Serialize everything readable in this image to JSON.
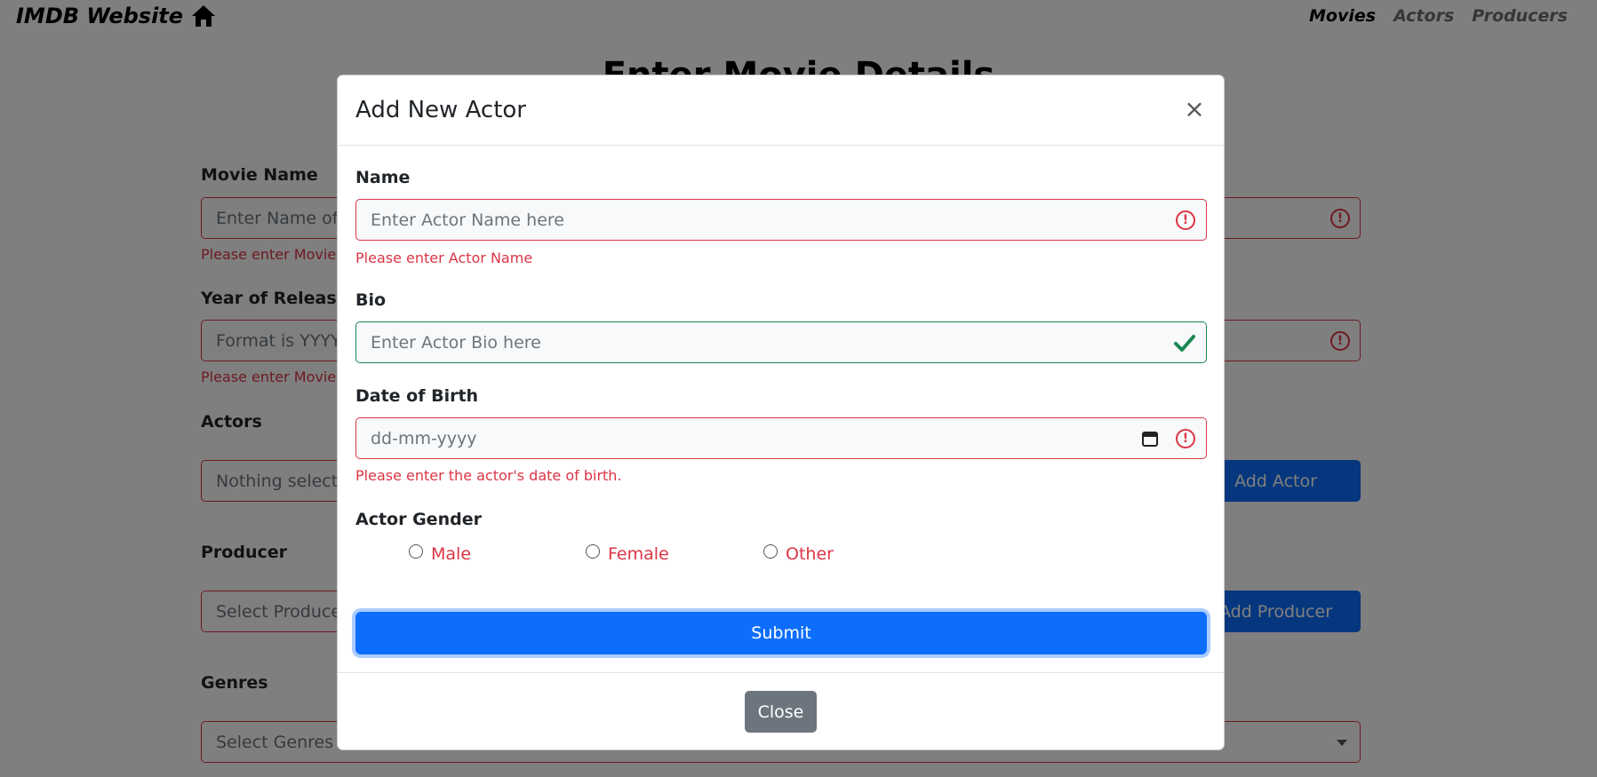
{
  "nav": {
    "brand": "IMDB Website",
    "links": [
      "Movies",
      "Actors",
      "Producers"
    ]
  },
  "page": {
    "heading": "Enter Movie Details",
    "movie_name_label": "Movie Name",
    "movie_name_placeholder": "Enter Name of Movie here",
    "movie_name_error": "Please enter Movie Name",
    "year_label": "Year of Release",
    "year_placeholder": "Format is YYYY",
    "year_error": "Please enter Movie Year of Release",
    "actors_label": "Actors",
    "actors_placeholder": "Nothing selected",
    "add_actor_button": "Add Actor",
    "producer_label": "Producer",
    "producer_placeholder": "Select Producer",
    "add_producer_button": "Add Producer",
    "genres_label": "Genres",
    "genres_placeholder": "Select Genres from list"
  },
  "modal": {
    "title": "Add New Actor",
    "close_symbol": "×",
    "name_label": "Name",
    "name_placeholder": "Enter Actor Name here",
    "name_error": "Please enter Actor Name",
    "bio_label": "Bio",
    "bio_placeholder": "Enter Actor Bio here",
    "dob_label": "Date of Birth",
    "dob_placeholder": "dd-mm-yyyy",
    "dob_error": "Please enter the actor's date of birth.",
    "gender_label": "Actor Gender",
    "gender_options": [
      "Male",
      "Female",
      "Other"
    ],
    "submit_label": "Submit",
    "close_label": "Close"
  },
  "icons": {
    "home": "home-icon",
    "error": "exclamation-circle-icon",
    "valid": "check-icon",
    "calendar": "calendar-icon"
  },
  "colors": {
    "primary": "#0d6efd",
    "danger": "#dc3545",
    "success": "#198754",
    "secondary": "#6c757d"
  }
}
